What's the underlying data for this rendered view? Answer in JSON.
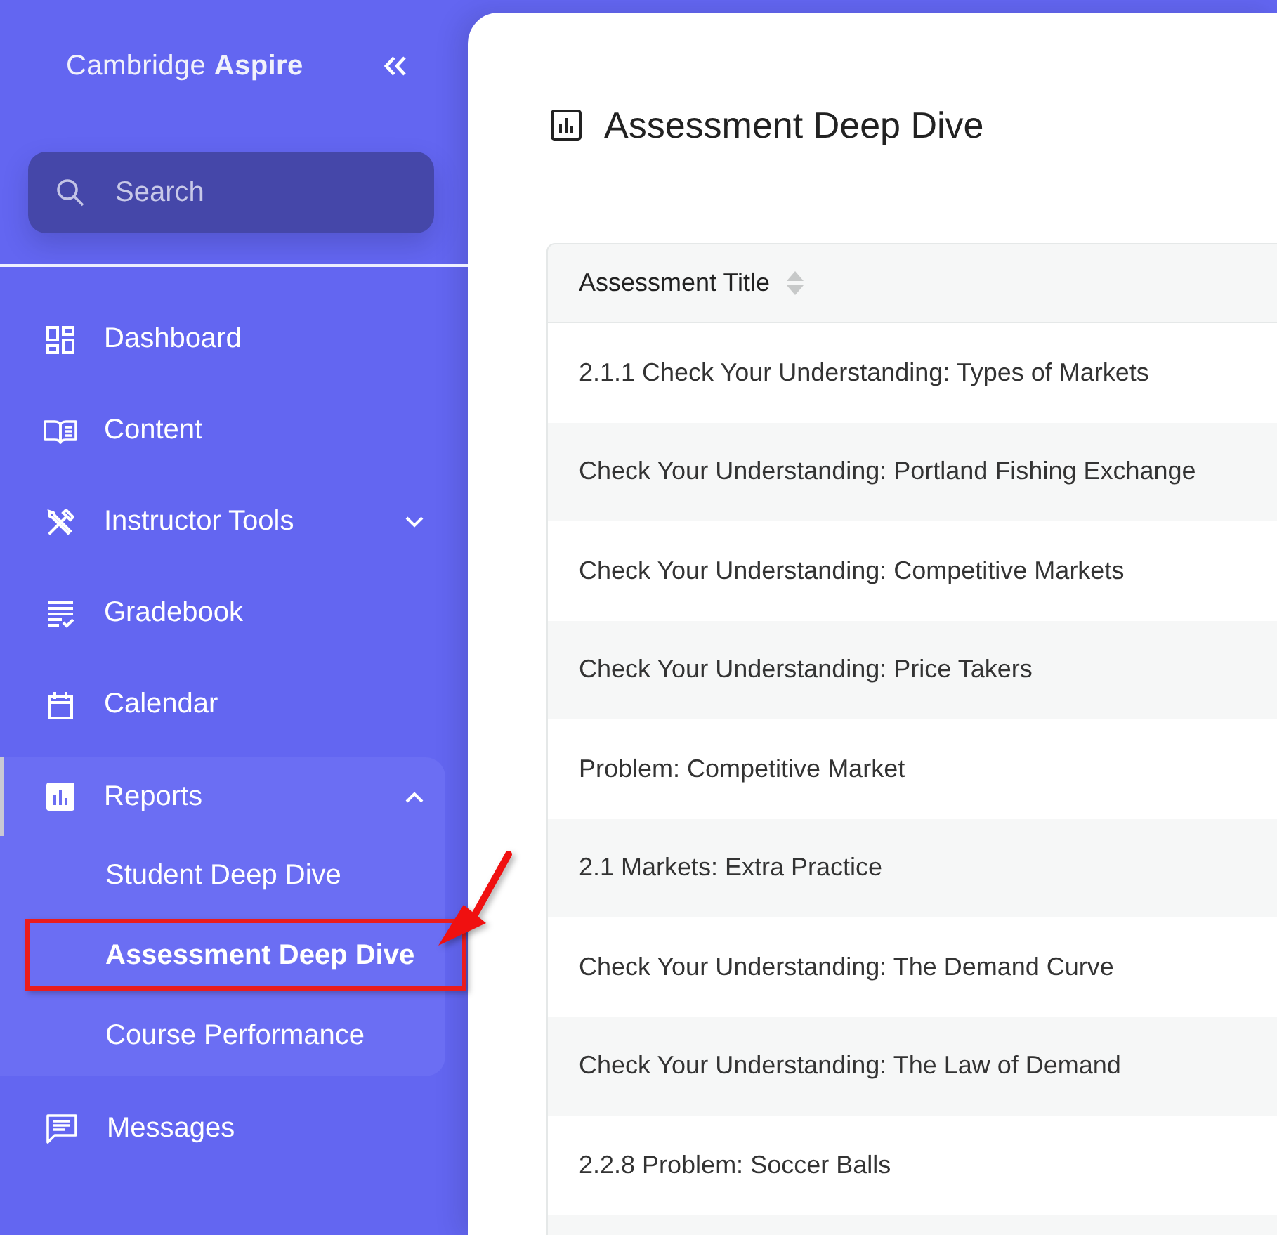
{
  "sidebar": {
    "logo": "Cambridge **Aspire**",
    "search": {
      "placeholder": "Search"
    },
    "nav": [
      {
        "label": "Dashboard",
        "selected": false
      },
      {
        "label": "Content",
        "selected": false
      },
      {
        "label": "Instructor Tools",
        "selected": false,
        "expanded": false
      },
      {
        "label": "Gradebook",
        "selected": false
      },
      {
        "label": "Calendar",
        "selected": false
      },
      {
        "label": "Reports",
        "selected": true,
        "expanded": true,
        "children": [
          {
            "label": "Student Deep Dive",
            "selected": false,
            "highlighted": false
          },
          {
            "label": "Assessment Deep Dive",
            "selected": true,
            "highlighted": true
          },
          {
            "label": "Course Performance",
            "selected": false,
            "highlighted": false
          }
        ]
      },
      {
        "label": "Messages",
        "selected": false
      }
    ]
  },
  "main": {
    "title": "Assessment Deep Dive",
    "table": {
      "columns": [
        {
          "label": "Assessment Title",
          "sortable": true
        }
      ],
      "rows": [
        [
          "2.1.1 Check Your Understanding: Types of Markets"
        ],
        [
          "Check Your Understanding: Portland Fishing Exchange"
        ],
        [
          "Check Your Understanding: Competitive Markets"
        ],
        [
          "Check Your Understanding: Price Takers"
        ],
        [
          "Problem: Competitive Market"
        ],
        [
          "2.1 Markets: Extra Practice"
        ],
        [
          "Check Your Understanding: The Demand Curve"
        ],
        [
          "Check Your Understanding: The Law of Demand"
        ],
        [
          "2.2.8 Problem: Soccer Balls"
        ]
      ]
    }
  }
}
